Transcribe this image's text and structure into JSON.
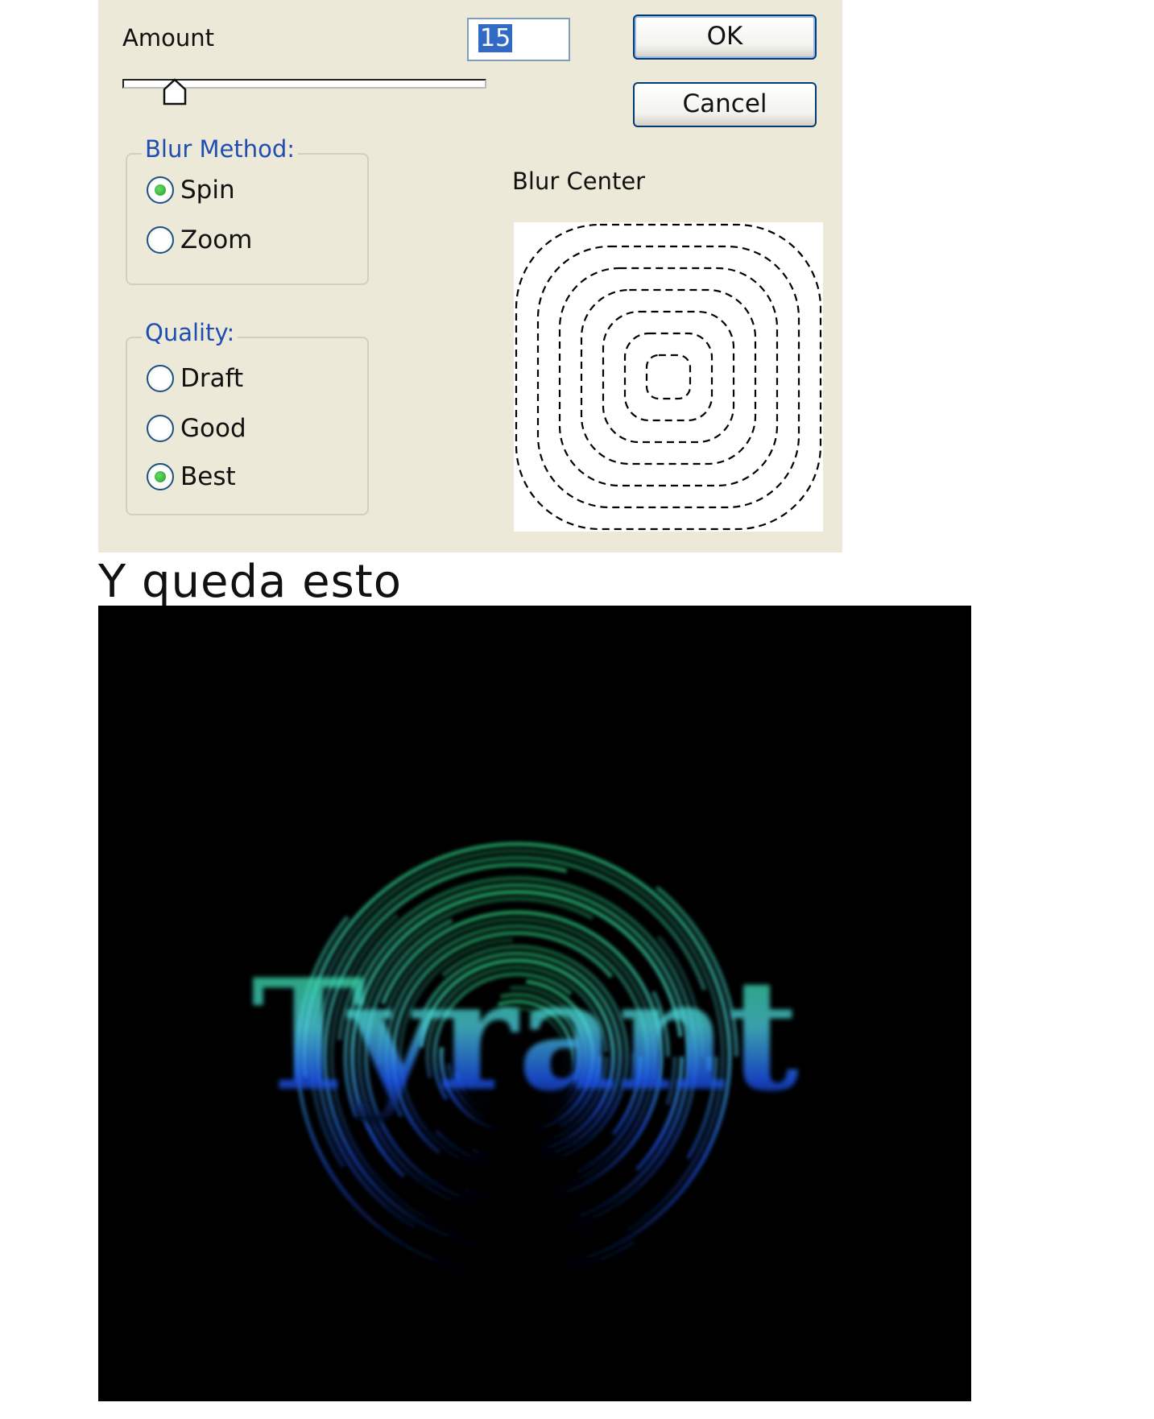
{
  "dialog": {
    "amount_label": "Amount",
    "amount_value": "15",
    "ok_label": "OK",
    "cancel_label": "Cancel",
    "blur_method": {
      "title": "Blur Method:",
      "options": [
        {
          "label": "Spin",
          "checked": true
        },
        {
          "label": "Zoom",
          "checked": false
        }
      ]
    },
    "quality": {
      "title": "Quality:",
      "options": [
        {
          "label": "Draft",
          "checked": false
        },
        {
          "label": "Good",
          "checked": false
        },
        {
          "label": "Best",
          "checked": true
        }
      ]
    },
    "blur_center_label": "Blur Center"
  },
  "caption": "Y queda esto",
  "result_image": {
    "text": "Tyrant",
    "colors": {
      "green": "#2ee38a",
      "cyan": "#4fd6e6",
      "blue": "#1f5bff",
      "background": "#000000"
    }
  }
}
